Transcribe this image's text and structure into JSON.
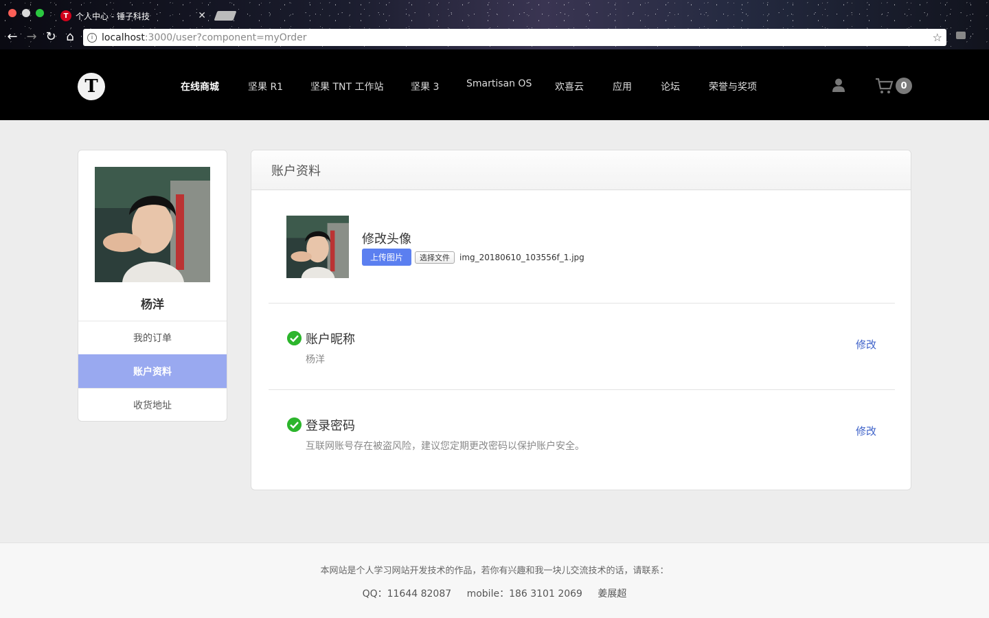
{
  "browser": {
    "tab_title": "个人中心 - 锤子科技",
    "favicon_letter": "T",
    "url_host": "localhost",
    "url_rest": ":3000/user?component=myOrder"
  },
  "header": {
    "logo_letter": "T",
    "nav": [
      "在线商城",
      "坚果 R1",
      "坚果 TNT 工作站",
      "坚果 3",
      "Smartisan OS",
      "欢喜云",
      "应用",
      "论坛",
      "荣誉与奖项"
    ],
    "active_nav": "在线商城",
    "cart_count": "0"
  },
  "sidebar": {
    "username": "杨洋",
    "items": [
      {
        "label": "我的订单",
        "active": false
      },
      {
        "label": "账户资料",
        "active": true
      },
      {
        "label": "收货地址",
        "active": false
      }
    ]
  },
  "panel": {
    "title": "账户资料",
    "avatar": {
      "title": "修改头像",
      "upload_label": "上传图片",
      "choose_file_label": "选择文件",
      "file_name": "img_20180610_103556f_1.jpg"
    },
    "nickname": {
      "title": "账户昵称",
      "value": "杨洋",
      "edit_label": "修改"
    },
    "password": {
      "title": "登录密码",
      "hint": "互联网账号存在被盗风险，建议您定期更改密码以保护账户安全。",
      "edit_label": "修改"
    }
  },
  "footer": {
    "line1": "本网站是个人学习网站开发技术的作品，若你有兴趣和我一块儿交流技术的话，请联系：",
    "qq": "QQ：11644 82087",
    "mobile": "mobile：186 3101 2069",
    "name": "姜展超"
  },
  "colors": {
    "accent": "#99a9f0",
    "upload_button": "#5b7ff0",
    "link": "#3e62c9",
    "check": "#2cb52c"
  }
}
